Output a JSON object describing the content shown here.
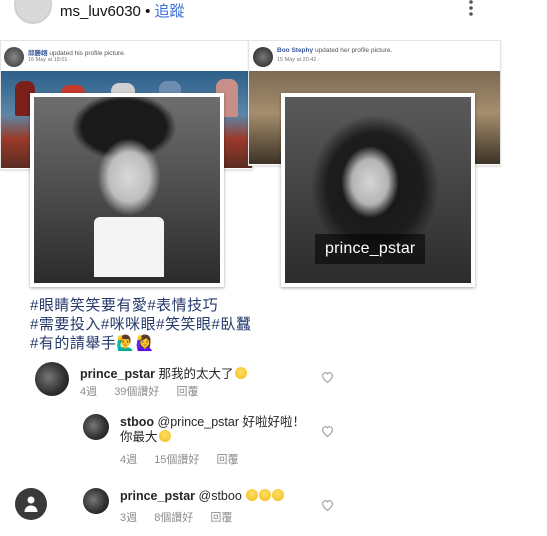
{
  "header": {
    "username": "ms_luv6030",
    "separator": "•",
    "follow_label": "追蹤",
    "more_icon": "more-vertical-icon"
  },
  "posts": [
    {
      "name": "邱勝翊",
      "action": "updated his profile picture.",
      "time": "16 May at 18:01 ·"
    },
    {
      "name": "Boo Stephy",
      "action": "updated her profile picture.",
      "time": "15 May at 20:42 ·"
    }
  ],
  "watermark": "prince_pstar",
  "caption": {
    "line1": "#眼睛笑笑要有愛#表情技巧",
    "line2": "#需要投入#咪咪眼#笑笑眼#臥蠶",
    "line3": "#有的請舉手🙋‍♂️🙋‍♀️"
  },
  "comments": [
    {
      "user": "prince_pstar",
      "text": "那我的太大了",
      "age": "4週",
      "likes": "39個讚好",
      "reply": "回覆"
    },
    {
      "user": "stboo",
      "text": "@prince_pstar 好啦好啦！",
      "text2": "你最大",
      "age": "4週",
      "likes": "15個讚好",
      "reply": "回覆"
    },
    {
      "user": "prince_pstar",
      "text": "@stboo",
      "age": "3週",
      "likes": "8個讚好",
      "reply": "回覆"
    }
  ],
  "icons": {
    "heart": "heart-outline-icon",
    "profile": "profile-icon",
    "emoji": "grinning-face-emoji"
  }
}
